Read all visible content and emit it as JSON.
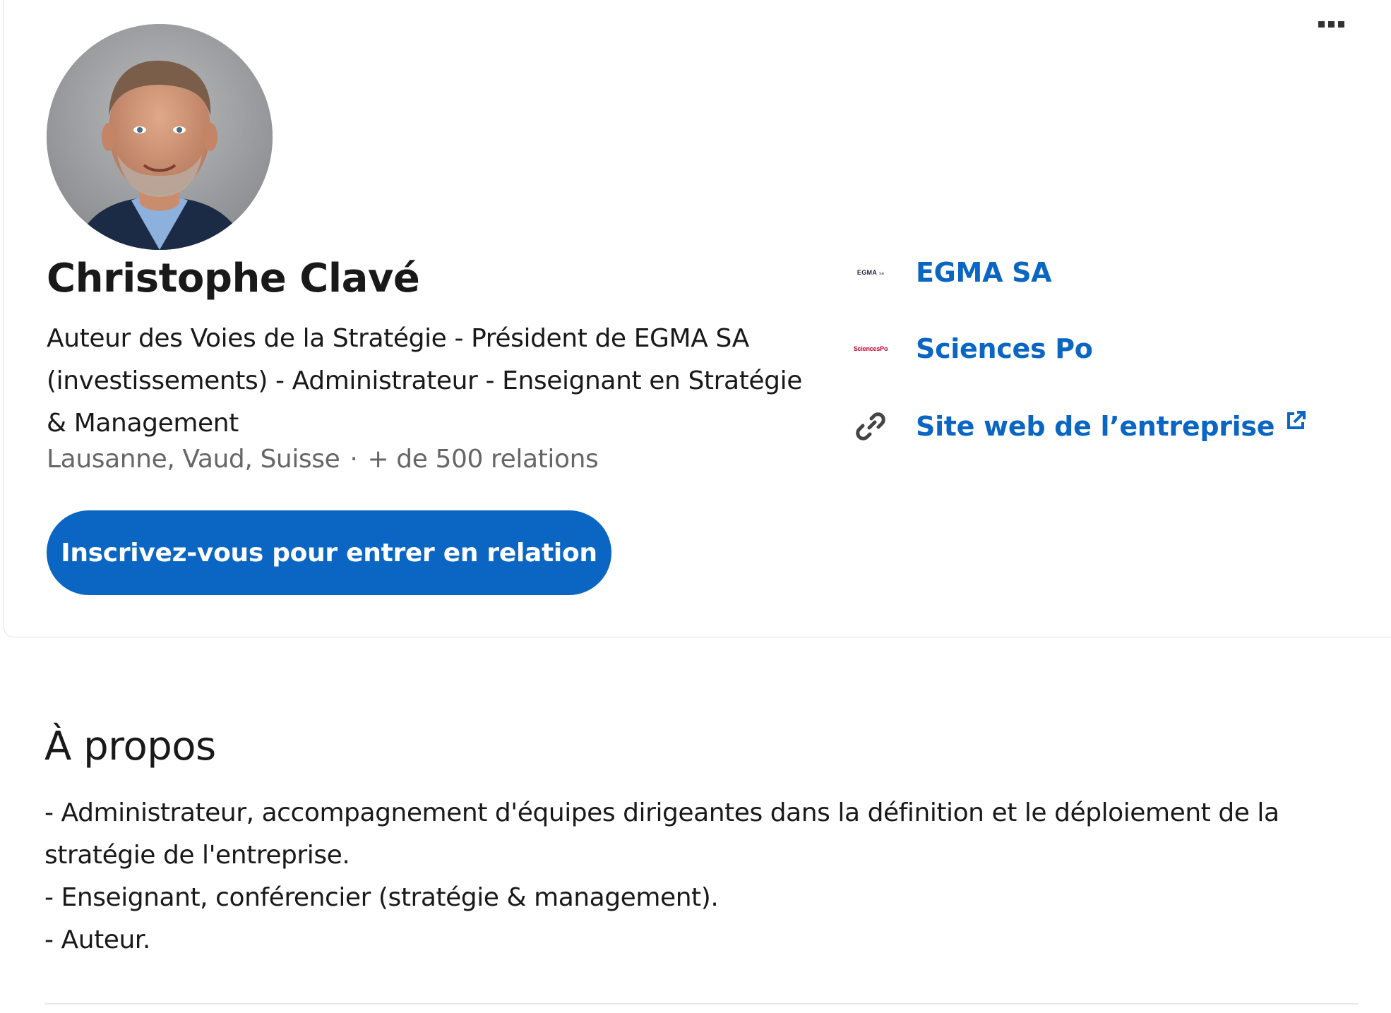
{
  "profile": {
    "name": "Christophe Clavé",
    "headline": "Auteur des Voies de la Stratégie - Président de EGMA SA (investissements) - Administrateur - Enseignant en Stratégie & Management",
    "location": "Lausanne, Vaud, Suisse",
    "separator": "·",
    "connections": "+ de 500 relations",
    "join_button_label": "Inscrivez-vous pour entrer en relation",
    "avatar_icon": "profile-photo",
    "more_icon": "more-options-icon"
  },
  "right_links": [
    {
      "label": "EGMA SA",
      "logo_text": "EGMA",
      "logo_sub": "sa",
      "icon": "egma-logo"
    },
    {
      "label": "Sciences Po",
      "logo_text": "SciencesPo",
      "icon": "sciencespo-logo"
    },
    {
      "label": "Site web de l’entreprise",
      "icon": "link-icon",
      "trailing_icon": "external-link-icon"
    }
  ],
  "about": {
    "title": "À propos",
    "lines": [
      "- Administrateur, accompagnement d'équipes dirigeantes dans la définition et le déploiement de la stratégie de l'entreprise.",
      "- Enseignant, conférencier (stratégie & management).",
      "- Auteur."
    ]
  },
  "colors": {
    "accent": "#0a66c2",
    "text": "#191919",
    "muted": "#666666",
    "border": "#e3e3e3"
  }
}
